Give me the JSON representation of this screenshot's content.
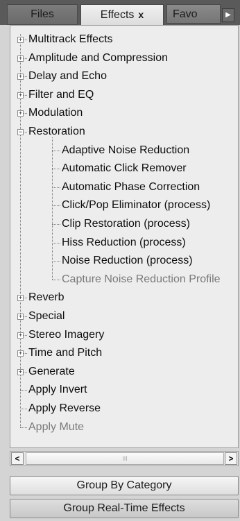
{
  "tabs": {
    "files": "Files",
    "effects": "Effects",
    "close_glyph": "x",
    "favorites": "Favo",
    "scroll_glyph": "▶"
  },
  "tree": [
    {
      "label": "Multitrack Effects",
      "level": 0,
      "expander": "+"
    },
    {
      "label": "Amplitude and Compression",
      "level": 0,
      "expander": "+"
    },
    {
      "label": "Delay and Echo",
      "level": 0,
      "expander": "+"
    },
    {
      "label": "Filter and EQ",
      "level": 0,
      "expander": "+"
    },
    {
      "label": "Modulation",
      "level": 0,
      "expander": "+"
    },
    {
      "label": "Restoration",
      "level": 0,
      "expander": "−"
    },
    {
      "label": "Adaptive Noise Reduction",
      "level": 1
    },
    {
      "label": "Automatic Click Remover",
      "level": 1
    },
    {
      "label": "Automatic Phase Correction",
      "level": 1
    },
    {
      "label": "Click/Pop Eliminator (process)",
      "level": 1
    },
    {
      "label": "Clip Restoration (process)",
      "level": 1
    },
    {
      "label": "Hiss Reduction (process)",
      "level": 1
    },
    {
      "label": "Noise Reduction (process)",
      "level": 1
    },
    {
      "label": "Capture Noise Reduction Profile",
      "level": 1,
      "dim": true
    },
    {
      "label": "Reverb",
      "level": 0,
      "expander": "+"
    },
    {
      "label": "Special",
      "level": 0,
      "expander": "+"
    },
    {
      "label": "Stereo Imagery",
      "level": 0,
      "expander": "+"
    },
    {
      "label": "Time and Pitch",
      "level": 0,
      "expander": "+"
    },
    {
      "label": "Generate",
      "level": 0,
      "expander": "+"
    },
    {
      "label": "Apply Invert",
      "level": 0
    },
    {
      "label": "Apply Reverse",
      "level": 0
    },
    {
      "label": "Apply Mute",
      "level": 0,
      "dim": true
    }
  ],
  "scrollbar": {
    "left_glyph": "<",
    "right_glyph": ">",
    "grip_glyph": "III"
  },
  "buttons": {
    "group_by_category": "Group By Category",
    "group_realtime": "Group Real-Time Effects"
  }
}
